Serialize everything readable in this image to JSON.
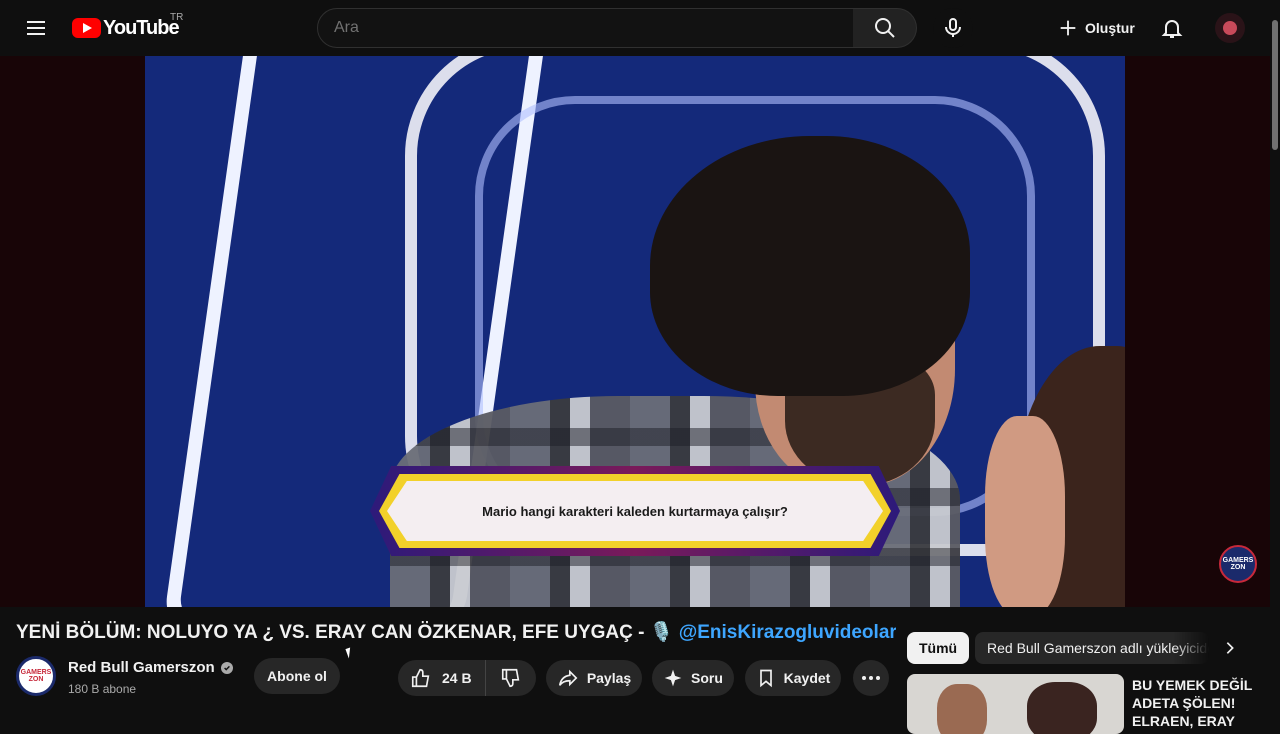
{
  "header": {
    "logo_text": "YouTube",
    "country_code": "TR",
    "search_placeholder": "Ara",
    "create_label": "Oluştur"
  },
  "video": {
    "question_text": "Mario hangi karakteri kaleden kurtarmaya çalışır?",
    "watermark_text": "GAMERS ZON"
  },
  "info": {
    "title": "YENİ BÖLÜM: NOLUYO YA ¿ VS. ERAY CAN ÖZKENAR, EFE UYGAÇ - 🎙️ ",
    "title_mention": "@EnisKirazogluvideolar",
    "channel_name": "Red Bull Gamerszon",
    "channel_avatar_text": "GAMERS ZON",
    "subscribers": "180 B abone",
    "subscribe_label": "Abone ol",
    "like_count": "24 B",
    "share_label": "Paylaş",
    "ask_label": "Soru",
    "save_label": "Kaydet"
  },
  "sidebar": {
    "chips": [
      "Tümü",
      "Red Bull Gamerszon adlı yükleyiciden"
    ],
    "recommendation_title": "BU YEMEK DEĞİL ADETA ŞÖLEN! ELRAEN, ERAY"
  },
  "colors": {
    "background": "#0f0f0f",
    "brand_red": "#ff0000",
    "link_blue": "#3ea6ff",
    "question_yellow": "#f2d12a"
  },
  "icons": [
    "menu-icon",
    "youtube-logo-icon",
    "search-icon",
    "mic-icon",
    "plus-icon",
    "bell-icon",
    "verified-icon",
    "thumbs-up-icon",
    "thumbs-down-icon",
    "share-icon",
    "sparkle-icon",
    "bookmark-icon",
    "more-icon",
    "chevron-right-icon"
  ]
}
